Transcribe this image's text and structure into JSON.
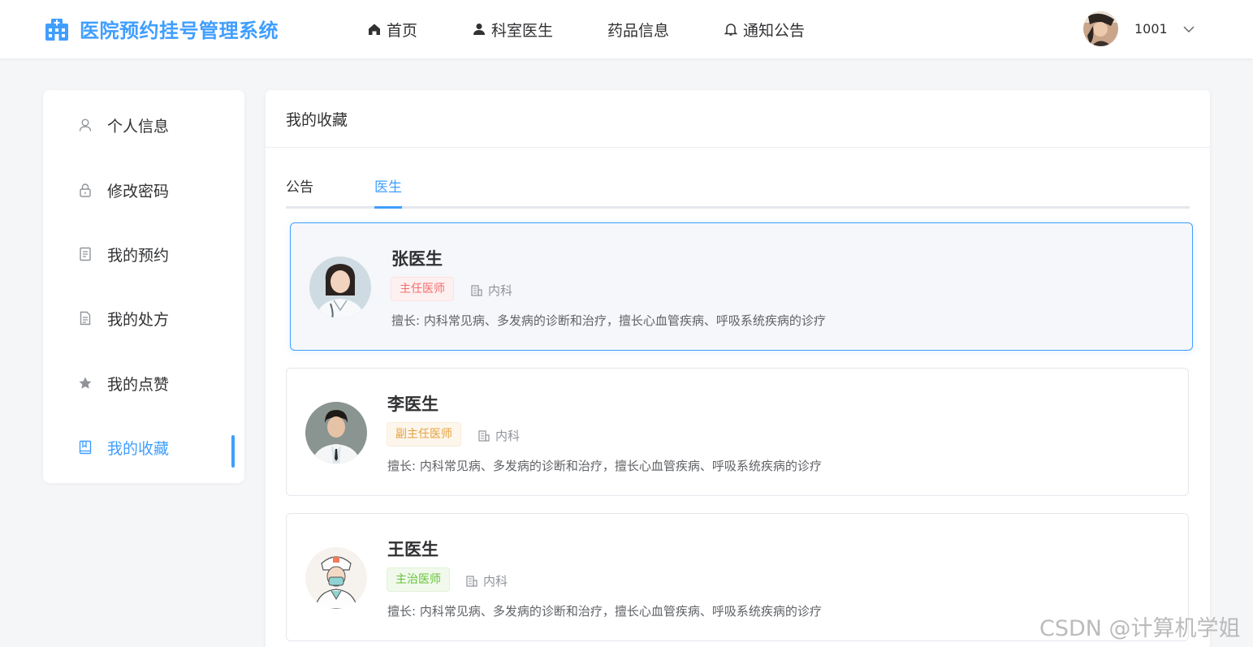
{
  "app": {
    "title": "医院预约挂号管理系统",
    "logo_icon": "hospital-icon",
    "brand_color": "#409eff"
  },
  "nav": [
    {
      "label": "首页",
      "icon": "home-icon"
    },
    {
      "label": "科室医生",
      "icon": "user-icon"
    },
    {
      "label": "药品信息",
      "icon": ""
    },
    {
      "label": "通知公告",
      "icon": "bell-icon"
    }
  ],
  "user": {
    "name": "1001"
  },
  "sidebar": {
    "items": [
      {
        "label": "个人信息",
        "icon": "user-outline-icon"
      },
      {
        "label": "修改密码",
        "icon": "lock-icon"
      },
      {
        "label": "我的预约",
        "icon": "notebook-icon"
      },
      {
        "label": "我的处方",
        "icon": "document-icon"
      },
      {
        "label": "我的点赞",
        "icon": "star-icon"
      },
      {
        "label": "我的收藏",
        "icon": "collection-icon",
        "active": true
      }
    ]
  },
  "main": {
    "title": "我的收藏",
    "tabs": [
      {
        "label": "公告"
      },
      {
        "label": "医生",
        "active": true
      }
    ],
    "doctors": [
      {
        "name": "张医生",
        "title": "主任医师",
        "title_color": "#f56c6c",
        "dept": "内科",
        "skill": "擅长: 内科常见病、多发病的诊断和治疗，擅长心血管疾病、呼吸系统疾病的诊疗"
      },
      {
        "name": "李医生",
        "title": "副主任医师",
        "title_color": "#e6a23c",
        "dept": "内科",
        "skill": "擅长: 内科常见病、多发病的诊断和治疗，擅长心血管疾病、呼吸系统疾病的诊疗"
      },
      {
        "name": "王医生",
        "title": "主治医师",
        "title_color": "#67c23a",
        "dept": "内科",
        "skill": "擅长: 内科常见病、多发病的诊断和治疗，擅长心血管疾病、呼吸系统疾病的诊疗"
      }
    ]
  },
  "watermark": "CSDN @计算机学姐"
}
